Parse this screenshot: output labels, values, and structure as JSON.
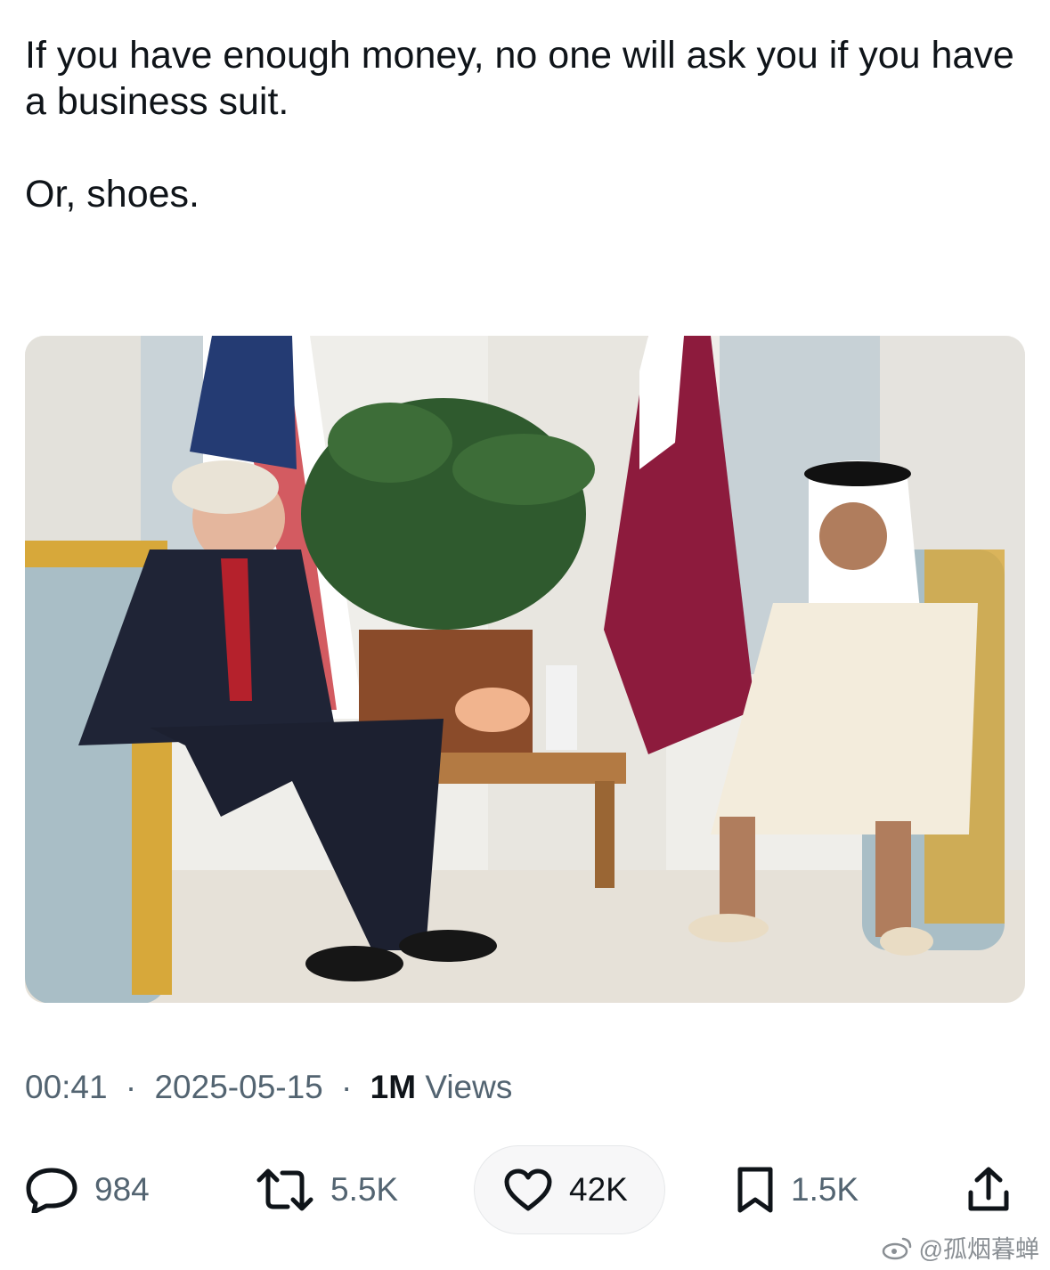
{
  "tweet": {
    "text_line1": "If you have enough money, no one will ask you if you have a business suit.",
    "text_line2": "Or, shoes."
  },
  "meta": {
    "time": "00:41",
    "date": "2025-05-15",
    "separator": "·",
    "views_count": "1M",
    "views_label": "Views"
  },
  "actions": {
    "replies": "984",
    "reposts": "5.5K",
    "likes": "42K",
    "bookmarks": "1.5K"
  },
  "watermark": {
    "text": "@孤烟暮蝉"
  },
  "colors": {
    "text_primary": "#0f1419",
    "text_secondary": "#536471",
    "qatar_maroon": "#8d1b3d"
  },
  "icons": [
    "reply-icon",
    "repost-icon",
    "like-icon",
    "bookmark-icon",
    "share-icon",
    "weibo-icon"
  ]
}
